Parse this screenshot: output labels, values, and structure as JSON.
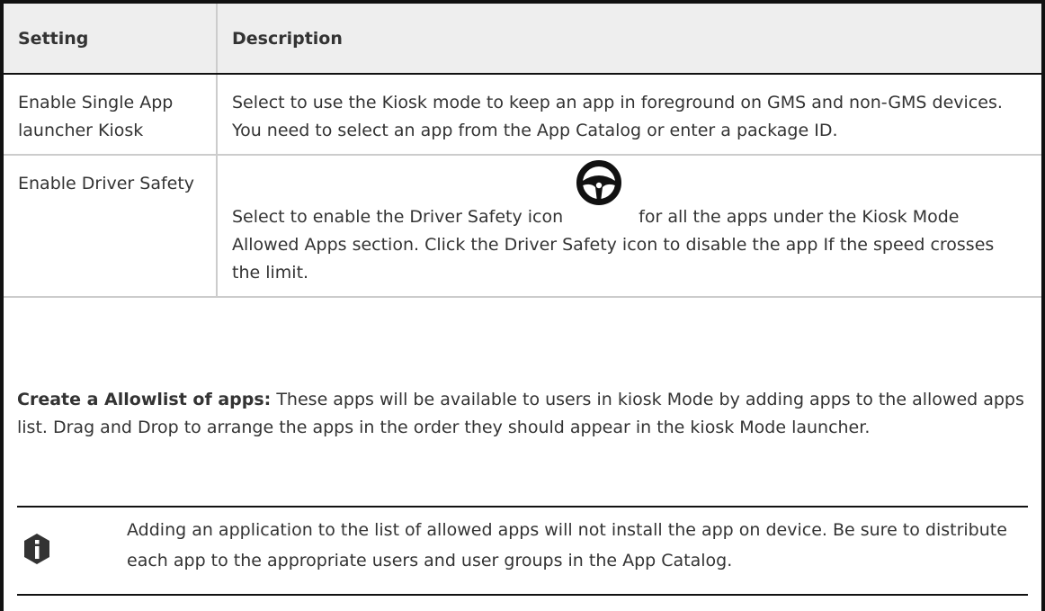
{
  "table": {
    "headers": {
      "setting": "Setting",
      "description": "Description"
    },
    "rows": [
      {
        "setting": "Enable Single App launcher Kiosk",
        "description": "Select to use the Kiosk mode to keep an app in foreground on GMS and non-GMS devices. You need to select an app from the App Catalog or enter a package ID."
      },
      {
        "setting": "Enable Driver Safety",
        "description_before_icon": "Select to enable the Driver Safety icon",
        "icon": "steering-wheel-icon",
        "description_after_icon": "for all the apps under the Kiosk Mode Allowed Apps section. Click the Driver Safety icon to disable the app If the speed crosses the limit."
      }
    ]
  },
  "allowlist": {
    "lead": "Create a Allowlist of apps:",
    "text": "These apps will be available to users in kiosk Mode by adding apps to the allowed apps list. Drag and Drop to arrange the apps in the order they should appear in the kiosk Mode launcher."
  },
  "note": {
    "icon": "info-icon",
    "text": "Adding an application to the list of allowed apps will not install the app on device. Be sure to distribute each app to the appropriate users and user groups in the App Catalog."
  },
  "colors": {
    "header_bg": "#eeeeee",
    "text": "#333333",
    "rule": "#111111",
    "cell_border": "#cccccc"
  }
}
